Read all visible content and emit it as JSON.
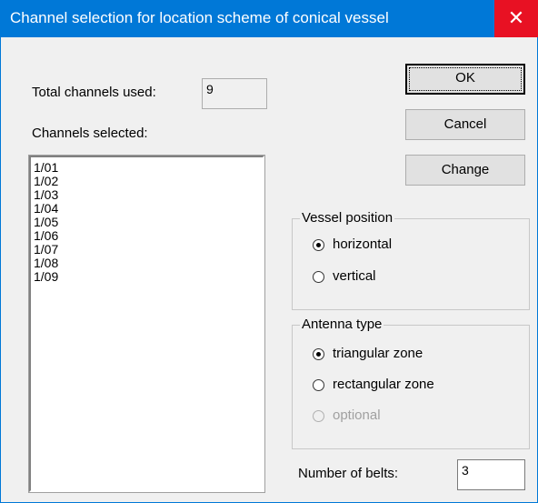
{
  "window": {
    "title": "Channel selection for location scheme of conical vessel",
    "close_glyph": "✕"
  },
  "total_channels": {
    "label": "Total channels used:",
    "value": "9"
  },
  "channels_selected": {
    "label": "Channels selected:",
    "items": [
      "1/01",
      "1/02",
      "1/03",
      "1/04",
      "1/05",
      "1/06",
      "1/07",
      "1/08",
      "1/09"
    ]
  },
  "buttons": {
    "ok": "OK",
    "cancel": "Cancel",
    "change": "Change"
  },
  "vessel_position": {
    "title": "Vessel position",
    "options": [
      {
        "label": "horizontal",
        "checked": true,
        "enabled": true
      },
      {
        "label": "vertical",
        "checked": false,
        "enabled": true
      }
    ]
  },
  "antenna_type": {
    "title": "Antenna type",
    "options": [
      {
        "label": "triangular zone",
        "checked": true,
        "enabled": true
      },
      {
        "label": "rectangular zone",
        "checked": false,
        "enabled": true
      },
      {
        "label": "optional",
        "checked": false,
        "enabled": false
      }
    ]
  },
  "belts": {
    "label": "Number of belts:",
    "value": "3"
  },
  "colors": {
    "title_bar": "#0078d7",
    "close_button": "#e81123",
    "background": "#f0f0f0"
  }
}
